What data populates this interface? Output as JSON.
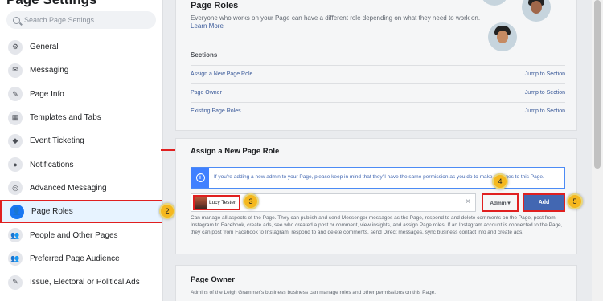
{
  "sidebar": {
    "title": "Page Settings",
    "search_placeholder": "Search Page Settings",
    "items": [
      {
        "label": "General",
        "icon": "⚙"
      },
      {
        "label": "Messaging",
        "icon": "✉"
      },
      {
        "label": "Page Info",
        "icon": "✎"
      },
      {
        "label": "Templates and Tabs",
        "icon": "▦"
      },
      {
        "label": "Event Ticketing",
        "icon": "◆"
      },
      {
        "label": "Notifications",
        "icon": "●"
      },
      {
        "label": "Advanced Messaging",
        "icon": "◎"
      },
      {
        "label": "Page Roles",
        "icon": "👤"
      },
      {
        "label": "People and Other Pages",
        "icon": "👥"
      },
      {
        "label": "Preferred Page Audience",
        "icon": "👥"
      },
      {
        "label": "Issue, Electoral or Political Ads",
        "icon": "✎"
      }
    ]
  },
  "page_roles": {
    "title": "Page Roles",
    "description": "Everyone who works on your Page can have a different role depending on what they need to work on.",
    "learn_more": "Learn More",
    "sections_heading": "Sections",
    "sections": [
      {
        "label": "Assign a New Page Role",
        "jump": "Jump to Section"
      },
      {
        "label": "Page Owner",
        "jump": "Jump to Section"
      },
      {
        "label": "Existing Page Roles",
        "jump": "Jump to Section"
      }
    ]
  },
  "assign": {
    "title": "Assign a New Page Role",
    "info_text": "If you're adding a new admin to your Page, please keep in mind that they'll have the same permission as you do to make changes to this Page.",
    "person_name": "Lucy Tester",
    "clear_symbol": "×",
    "role": "Admin ▾",
    "add_label": "Add",
    "permission_text": "Can manage all aspects of the Page. They can publish and send Messenger messages as the Page, respond to and delete comments on the Page, post from Instagram to Facebook, create ads, see who created a post or comment, view insights, and assign Page roles. If an Instagram account is connected to the Page, they can post from Facebook to Instagram, respond to and delete comments, send Direct messages, sync business contact info and create ads."
  },
  "owner": {
    "title": "Page Owner",
    "description": "Admins of the Leigh Grammer's business business can manage roles and other permissions on this Page."
  },
  "callouts": {
    "n2": "2",
    "n3": "3",
    "n4": "4",
    "n5": "5"
  },
  "colors": {
    "highlight": "#e02020",
    "badge": "#f5b81f",
    "button": "#4267b2",
    "link": "#385898"
  }
}
